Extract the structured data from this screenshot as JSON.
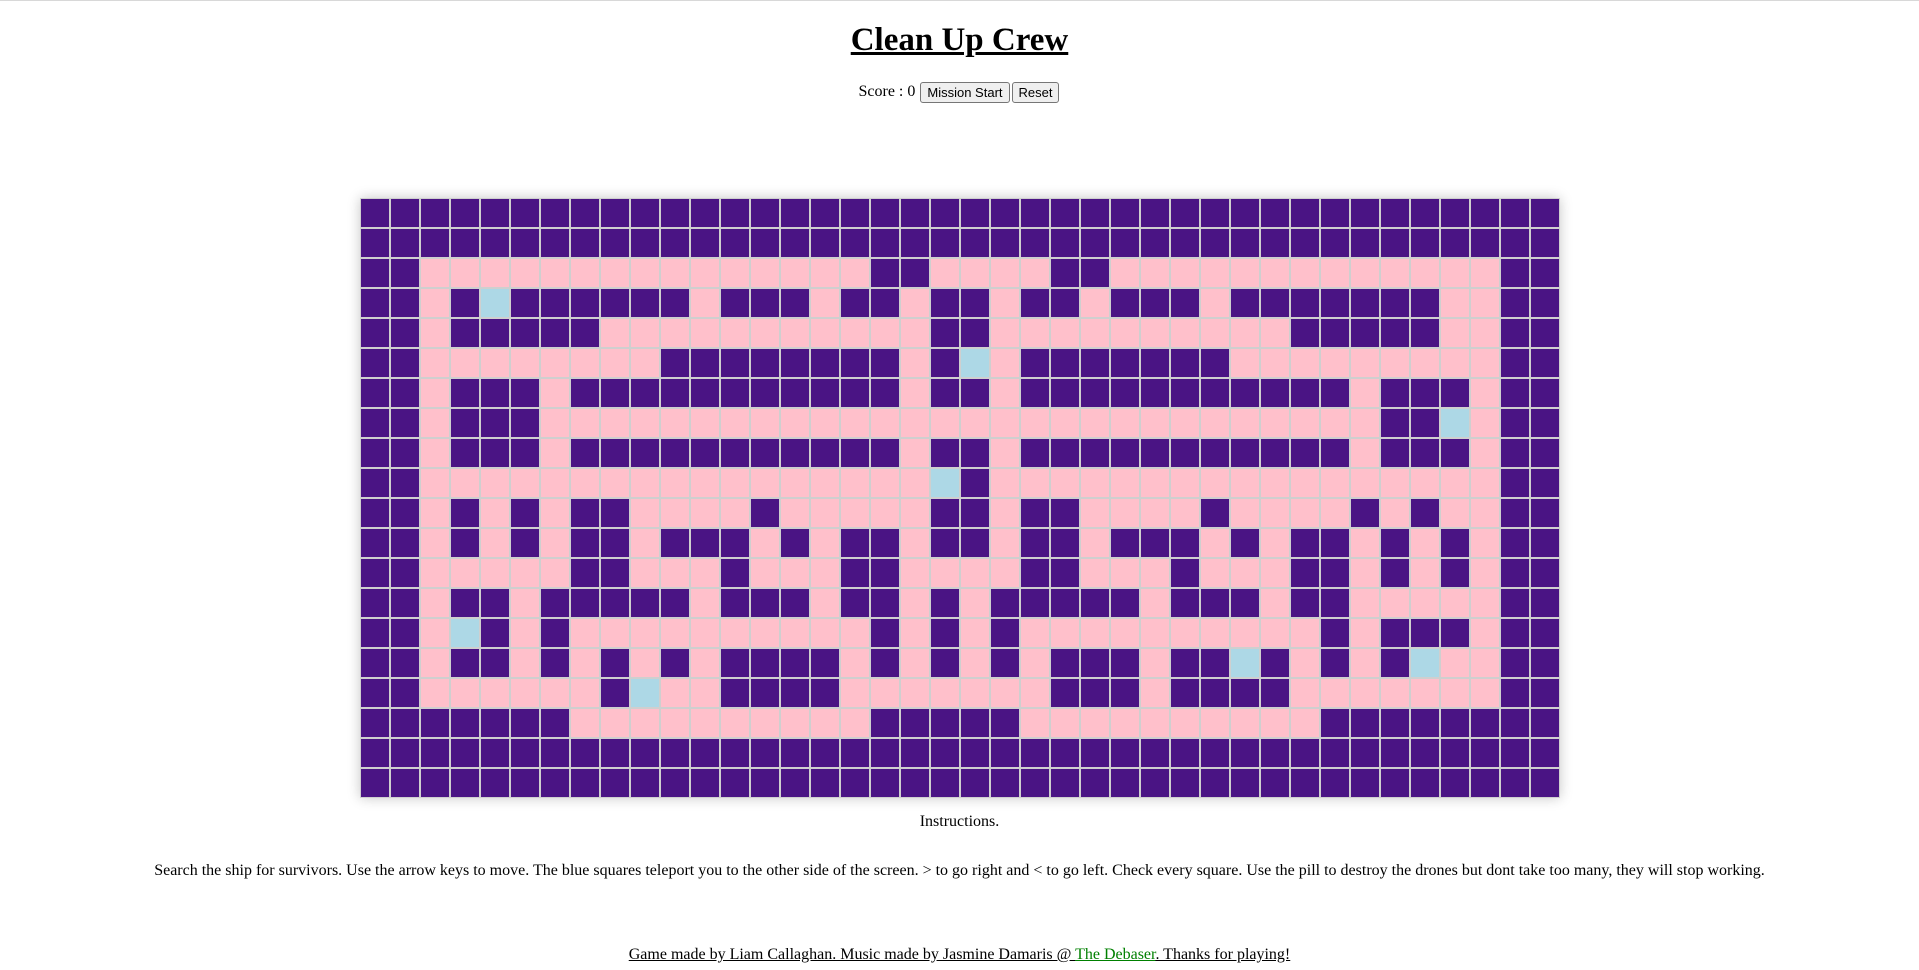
{
  "title": "Clean Up Crew",
  "score": {
    "label": "Score : ",
    "value": "0"
  },
  "buttons": {
    "start": "Mission Start",
    "reset": "Reset"
  },
  "colors": {
    "wall": "#4a1484",
    "path": "#ffc0cb",
    "teleport": "#add8e6",
    "gridline": "#cfcfcf",
    "link": "#008000"
  },
  "maze": {
    "legend": {
      "W": "wall",
      "P": "path",
      "T": "teleport"
    },
    "rows": [
      "WWWWWWWWWWWWWWWWWWWWWWWWWWWWWWWWWWWWWWWW",
      "WWWWWWWWWWWWWWWWWWWWWWWWWWWWWWWWWWWWWWWW",
      "WWPPPPPPPPPPPPPPPWWPPPPWWPPPPPPPPPPPPPWW",
      "WWPWTWWWWWWPWWWPWWPWWPWWPWWWPWWWWWWWPPWW",
      "WWPWWWWWPPPPPPPPPPPWWPPPPPPPPPPWWWWWPPWW",
      "WWPPPPPPPPWWWWWWWWPWTPWWWWWWWPPPPPPPPPWW",
      "WWPWWWPWWWWWWWWWWWPWWPWWWWWWWWWWWPWWWPWW",
      "WWPWWWPPPPPPPPPPPPPPPPPPPPPPPPPPPPWWTPWW",
      "WWPWWWPWWWWWWWWWWWPWWPWWWWWWWWWWWPWWWPWW",
      "WWPPPPPPPPPPPPPPPPPTWPPPPPPPPPPPPPPPPPWW",
      "WWPWPWPWWPPPPWPPPPPWWPWWPPPPWPPPPWPWPPWW",
      "WWPWPWPWWPWWWPWPWWPWWPWWPWWWPWPWWPWPWPWW",
      "WWPPPPPWWPPPWPPPWWPPPPWWPPPWPPPWWPWPWPWW",
      "WWPWWPWWWWWPWWWPWWPWPWWWWWPWWWPWWPPPPPWW",
      "WWPTWPWPPPPPPPPPPWPWPWPPPPPPPPPPWPWWWPWW",
      "WWPWWPWPWPWPWWWWPWPWPWPWWWPWWTWPWPWTPPWW",
      "WWPPPPPPWTPPWWWWPPPPPPPWWWPWWWWPPPPPPPWW",
      "WWWWWWWPPPPPPPPPPWWWWWPPPPPPPPPPWWWWWWWW",
      "WWWWWWWWWWWWWWWWWWWWWWWWWWWWWWWWWWWWWWWW",
      "WWWWWWWWWWWWWWWWWWWWWWWWWWWWWWWWWWWWWWWW"
    ]
  },
  "instructions": {
    "heading": "Instructions.",
    "text": "Search the ship for survivors. Use the arrow keys to move. The blue squares teleport you to the other side of the screen. > to go right and < to go left. Check every square. Use the pill to destroy the drones but dont take too many, they will stop working."
  },
  "footer": {
    "prefix": "Game made by Liam Callaghan. Music made by Jasmine Damaris @ ",
    "link_text": "The Debaser",
    "suffix": ". Thanks for playing!"
  }
}
